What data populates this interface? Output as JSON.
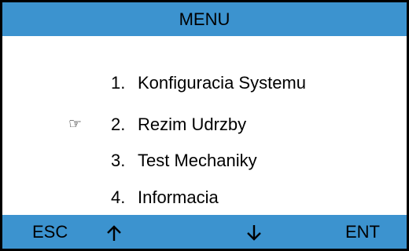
{
  "header": {
    "title": "MENU"
  },
  "menu": {
    "selected_index": 2,
    "pointer_icon": "pointing-hand-icon",
    "pointer_glyph": "☞",
    "items": [
      {
        "number": "1.",
        "label": "Konfiguracia Systemu"
      },
      {
        "number": "2.",
        "label": "Rezim Udrzby"
      },
      {
        "number": "3.",
        "label": "Test Mechaniky"
      },
      {
        "number": "4.",
        "label": "Informacia"
      }
    ]
  },
  "softkeys": {
    "esc_label": "ESC",
    "up_icon": "arrow-up-icon",
    "down_icon": "arrow-down-icon",
    "ent_label": "ENT"
  },
  "colors": {
    "bar_background": "#3c93cf",
    "screen_background": "#ffffff",
    "border": "#000000",
    "text": "#000000"
  }
}
